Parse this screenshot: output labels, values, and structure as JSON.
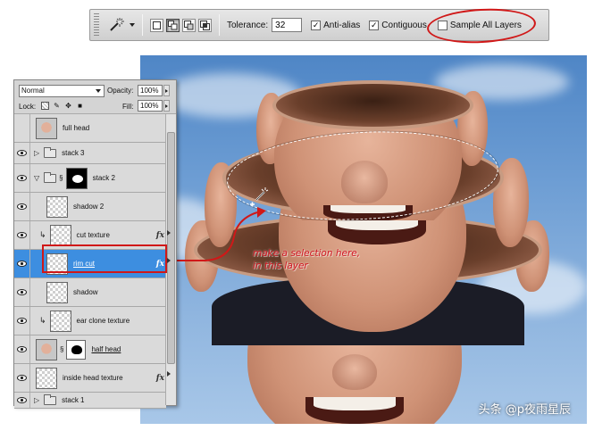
{
  "options_bar": {
    "tool_icon": "magic-wand-icon",
    "tolerance_label": "Tolerance:",
    "tolerance_value": "32",
    "antialias_label": "Anti-alias",
    "antialias_checked": true,
    "contiguous_label": "Contiguous",
    "contiguous_checked": true,
    "sample_all_label": "Sample All Layers",
    "sample_all_checked": false
  },
  "layers_panel": {
    "blend_mode": "Normal",
    "opacity_label": "Opacity:",
    "opacity_value": "100%",
    "lock_label": "Lock:",
    "fill_label": "Fill:",
    "fill_value": "100%",
    "layers": [
      {
        "name": "full head",
        "visible": false,
        "kind": "layer",
        "thumb": "face"
      },
      {
        "name": "stack 3",
        "visible": true,
        "kind": "group",
        "expanded": false
      },
      {
        "name": "stack 2",
        "visible": true,
        "kind": "group",
        "expanded": true
      },
      {
        "name": "shadow 2",
        "visible": true,
        "kind": "layer",
        "thumb": "transparent"
      },
      {
        "name": "cut texture",
        "visible": true,
        "kind": "clipped",
        "fx": "fx"
      },
      {
        "name": "rim cut",
        "visible": true,
        "kind": "layer",
        "fx": "fx",
        "selected": true
      },
      {
        "name": "shadow",
        "visible": true,
        "kind": "layer",
        "thumb": "transparent"
      },
      {
        "name": "ear clone texture",
        "visible": true,
        "kind": "clipped"
      },
      {
        "name": "half head",
        "visible": true,
        "kind": "masked"
      },
      {
        "name": "inside head texture",
        "visible": true,
        "kind": "layer",
        "fx": "fx"
      },
      {
        "name": "stack 1",
        "visible": true,
        "kind": "group",
        "expanded": false
      }
    ]
  },
  "annotation": {
    "line1": "make a selection here,",
    "line2": "in this layer",
    "color": "#d0141e"
  },
  "watermark": "头条 @p夜雨星辰"
}
